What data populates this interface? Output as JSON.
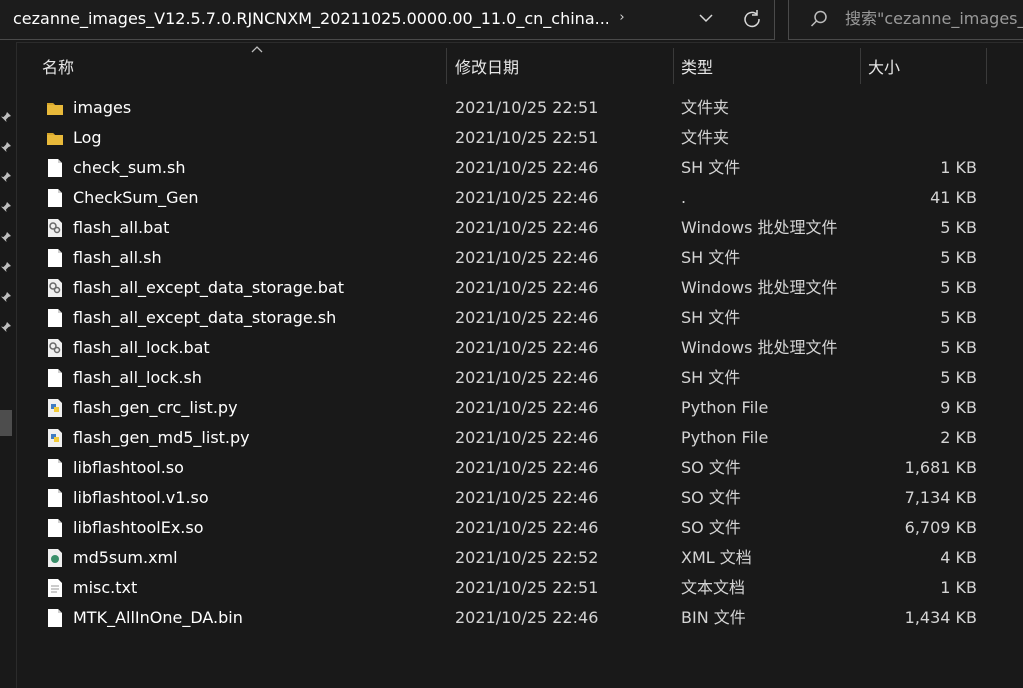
{
  "address": {
    "path": "cezanne_images_V12.5.7.0.RJNCNXM_20211025.0000.00_11.0_cn_china...",
    "chevron": "›"
  },
  "search": {
    "placeholder": "搜索\"cezanne_images_..."
  },
  "icons": {
    "dropdown": "chevron-down-icon",
    "refresh": "refresh-icon",
    "search": "search-icon",
    "pin": "pin-icon",
    "sort": "sort-ascending-icon"
  },
  "colors": {
    "background": "#191919",
    "folder": "#e8b93a",
    "text": "#ffffff",
    "muted": "#d4d4d4",
    "python_blue": "#3f7cc2",
    "python_yellow": "#f2cc3a"
  },
  "columns": {
    "name": "名称",
    "date": "修改日期",
    "type": "类型",
    "size": "大小"
  },
  "files": [
    {
      "name": "images",
      "date": "2021/10/25 22:51",
      "type": "文件夹",
      "size": "",
      "icon": "folder-icon"
    },
    {
      "name": "Log",
      "date": "2021/10/25 22:51",
      "type": "文件夹",
      "size": "",
      "icon": "folder-icon"
    },
    {
      "name": "check_sum.sh",
      "date": "2021/10/25 22:46",
      "type": "SH 文件",
      "size": "1 KB",
      "icon": "file-icon"
    },
    {
      "name": "CheckSum_Gen",
      "date": "2021/10/25 22:46",
      "type": ".",
      "size": "41 KB",
      "icon": "file-icon"
    },
    {
      "name": "flash_all.bat",
      "date": "2021/10/25 22:46",
      "type": "Windows 批处理文件",
      "size": "5 KB",
      "icon": "batch-file-icon"
    },
    {
      "name": "flash_all.sh",
      "date": "2021/10/25 22:46",
      "type": "SH 文件",
      "size": "5 KB",
      "icon": "file-icon"
    },
    {
      "name": "flash_all_except_data_storage.bat",
      "date": "2021/10/25 22:46",
      "type": "Windows 批处理文件",
      "size": "5 KB",
      "icon": "batch-file-icon"
    },
    {
      "name": "flash_all_except_data_storage.sh",
      "date": "2021/10/25 22:46",
      "type": "SH 文件",
      "size": "5 KB",
      "icon": "file-icon"
    },
    {
      "name": "flash_all_lock.bat",
      "date": "2021/10/25 22:46",
      "type": "Windows 批处理文件",
      "size": "5 KB",
      "icon": "batch-file-icon"
    },
    {
      "name": "flash_all_lock.sh",
      "date": "2021/10/25 22:46",
      "type": "SH 文件",
      "size": "5 KB",
      "icon": "file-icon"
    },
    {
      "name": "flash_gen_crc_list.py",
      "date": "2021/10/25 22:46",
      "type": "Python File",
      "size": "9 KB",
      "icon": "python-file-icon"
    },
    {
      "name": "flash_gen_md5_list.py",
      "date": "2021/10/25 22:46",
      "type": "Python File",
      "size": "2 KB",
      "icon": "python-file-icon"
    },
    {
      "name": "libflashtool.so",
      "date": "2021/10/25 22:46",
      "type": "SO 文件",
      "size": "1,681 KB",
      "icon": "file-icon"
    },
    {
      "name": "libflashtool.v1.so",
      "date": "2021/10/25 22:46",
      "type": "SO 文件",
      "size": "7,134 KB",
      "icon": "file-icon"
    },
    {
      "name": "libflashtoolEx.so",
      "date": "2021/10/25 22:46",
      "type": "SO 文件",
      "size": "6,709 KB",
      "icon": "file-icon"
    },
    {
      "name": "md5sum.xml",
      "date": "2021/10/25 22:52",
      "type": "XML 文档",
      "size": "4 KB",
      "icon": "xml-file-icon"
    },
    {
      "name": "misc.txt",
      "date": "2021/10/25 22:51",
      "type": "文本文档",
      "size": "1 KB",
      "icon": "text-file-icon"
    },
    {
      "name": "MTK_AllInOne_DA.bin",
      "date": "2021/10/25 22:46",
      "type": "BIN 文件",
      "size": "1,434 KB",
      "icon": "file-icon"
    }
  ]
}
